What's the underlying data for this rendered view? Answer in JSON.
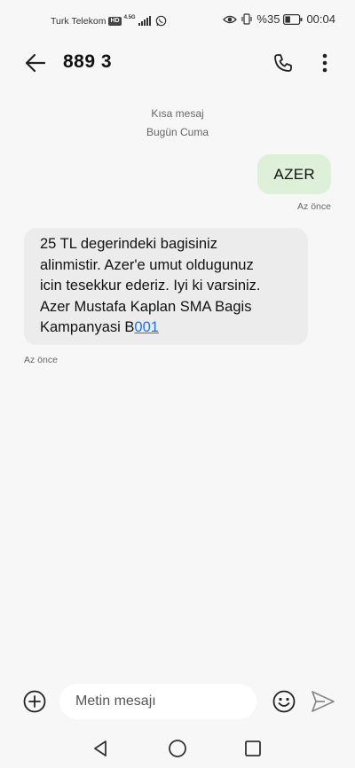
{
  "status_bar": {
    "carrier": "Turk Telekom",
    "hd_badge": "HD",
    "network": "4.5G",
    "battery_percent": "%35",
    "time": "00:04"
  },
  "header": {
    "contact": "889 3"
  },
  "thread": {
    "type_label": "Kısa mesaj",
    "date_label": "Bugün Cuma"
  },
  "messages": {
    "outgoing": {
      "text": "AZER",
      "time": "Az önce"
    },
    "incoming": {
      "line1": "25 TL degerindeki bagisiniz",
      "line2": "alinmistir. Azer'e umut oldugunuz",
      "line3": "icin tesekkur ederiz. Iyi ki varsiniz.",
      "line4": "Azer Mustafa Kaplan SMA Bagis",
      "line5_prefix": "Kampanyasi B",
      "line5_link": "001",
      "time": "Az önce"
    }
  },
  "composer": {
    "placeholder": "Metin mesajı"
  },
  "colors": {
    "outgoing_bubble": "#dff0da",
    "incoming_bubble": "#ececec",
    "link": "#1a73e8",
    "background": "#f7f7f7"
  },
  "icons": [
    "back-arrow-icon",
    "phone-icon",
    "more-vert-icon",
    "add-circle-icon",
    "emoji-icon",
    "send-icon",
    "nav-back-icon",
    "nav-home-icon",
    "nav-recent-icon",
    "eye-icon",
    "vibrate-icon",
    "battery-icon",
    "whatsapp-icon",
    "signal-icon"
  ]
}
